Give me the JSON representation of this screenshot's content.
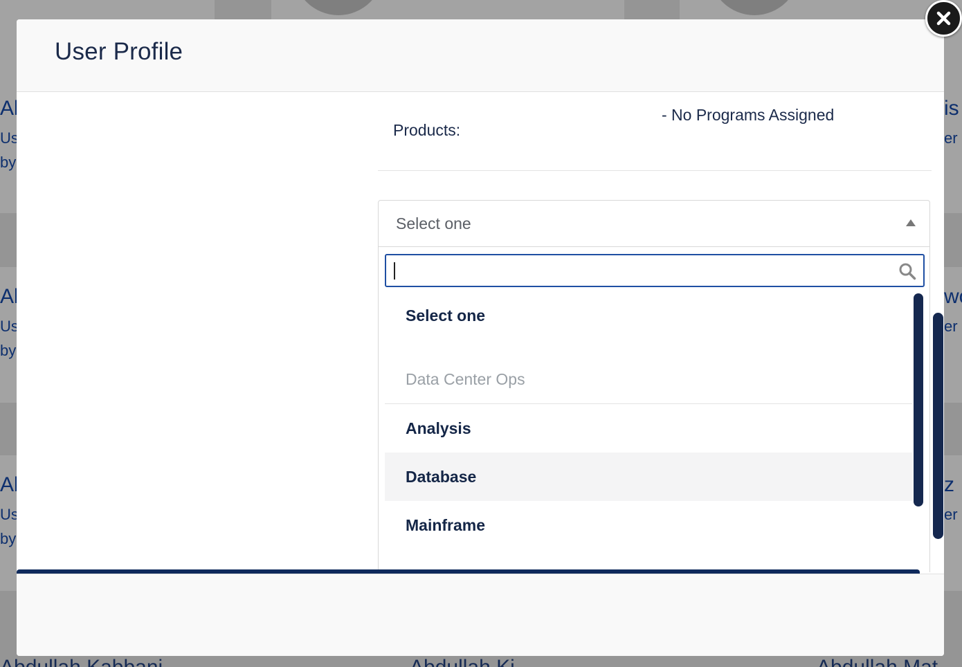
{
  "modal": {
    "title": "User Profile",
    "products_label": "Products:",
    "programs_text": "- No Programs Assigned"
  },
  "select": {
    "value": "Select one"
  },
  "dropdown": {
    "search_value": "",
    "options": [
      {
        "label": "Select one",
        "type": "option"
      },
      {
        "label": "Data Center Ops",
        "type": "group"
      },
      {
        "label": "Analysis",
        "type": "option"
      },
      {
        "label": "Database",
        "type": "option",
        "highlighted": true
      },
      {
        "label": "Mainframe",
        "type": "option"
      }
    ]
  },
  "icons": {
    "close": "close-icon",
    "search": "search-icon",
    "arrow": "triangle-up-icon"
  },
  "background": {
    "fragments_left": [
      "Al",
      "Us",
      "by",
      "Al",
      "Us",
      "by",
      "Al",
      "Us",
      "by"
    ],
    "fragments_right": [
      "is",
      "er",
      "wo",
      "er",
      "z",
      "er"
    ],
    "names_bottom": [
      "Abdullah Kabbani",
      "Abdullah Ki",
      "Abdullah Mat"
    ]
  },
  "colors": {
    "primary_navy": "#15284f",
    "focus_blue": "#1f4fa3",
    "text": "#1b2a4a",
    "muted": "#9aa0a6"
  }
}
